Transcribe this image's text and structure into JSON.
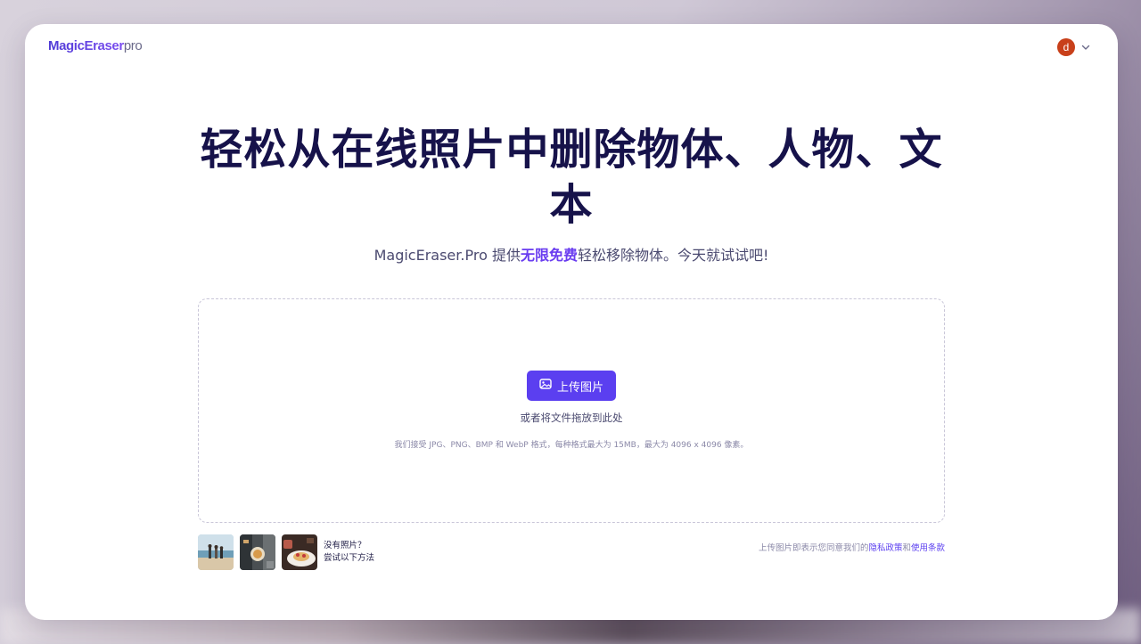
{
  "header": {
    "logo_main": "MagicEraser",
    "logo_suffix": "pro",
    "avatar_letter": "d"
  },
  "hero": {
    "title": "轻松从在线照片中删除物体、人物、文本",
    "subtitle_prefix": "MagicEraser.Pro 提供",
    "subtitle_highlight": "无限免费",
    "subtitle_suffix": "轻松移除物体。今天就试试吧!"
  },
  "upload": {
    "button_label": "上传图片",
    "drop_hint": "或者将文件拖放到此处",
    "formats_note": "我们接受 JPG、PNG、BMP 和 WebP 格式，每种格式最大为 15MB，最大为 4096 x 4096 像素。"
  },
  "samples": {
    "line1": "没有照片？",
    "line2": "尝试以下方法",
    "items": [
      "beach-people",
      "street-sign",
      "food-plate"
    ]
  },
  "legal": {
    "prefix": "上传图片即表示您同意我们的",
    "privacy_link": "隐私政策",
    "joiner": "和",
    "terms_link": "使用条款"
  },
  "colors": {
    "accent": "#5b3ff0",
    "headline": "#16124a",
    "avatar": "#c8401a"
  }
}
